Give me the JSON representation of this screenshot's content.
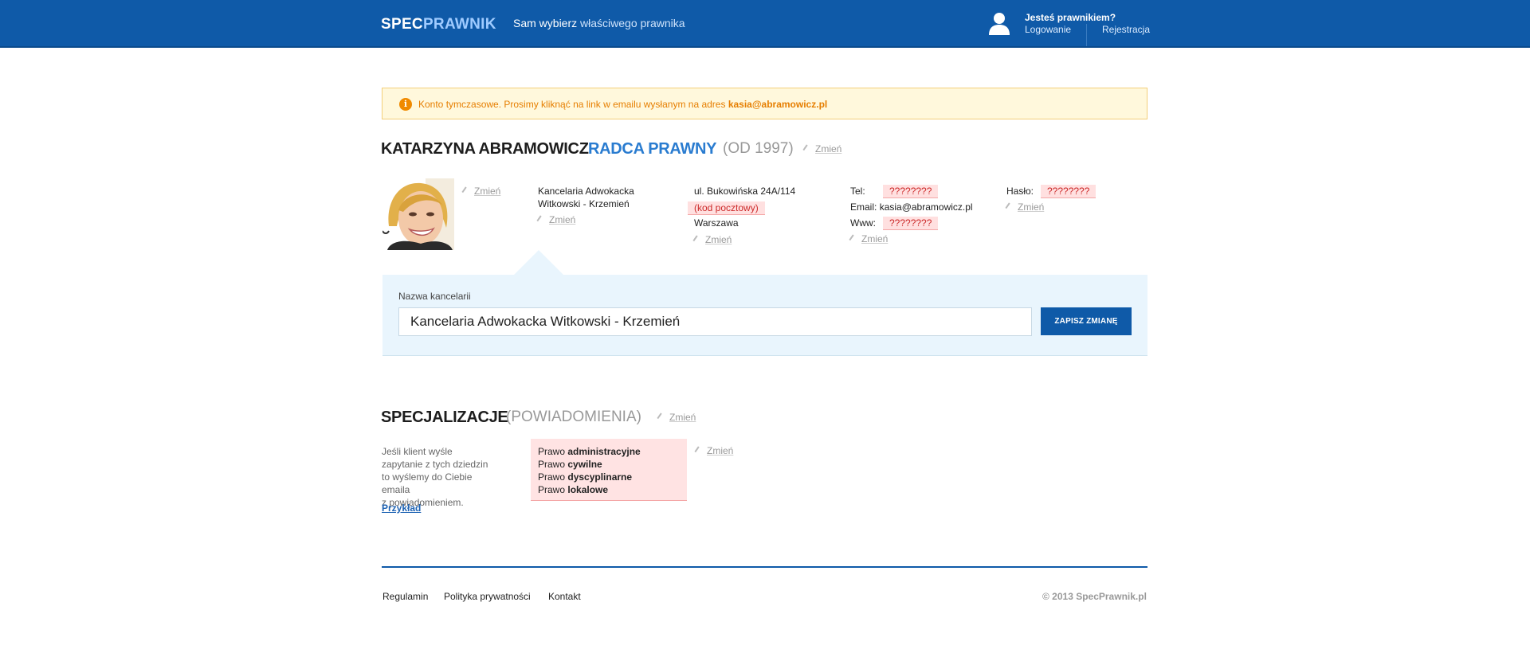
{
  "header": {
    "logo_a": "SPEC",
    "logo_b": "PRAWNIK",
    "tagline_a": "Sam wybierz",
    "tagline_b": " właściwego prawnika",
    "lawyer_question": "Jesteś prawnikiem?",
    "login": "Logowanie",
    "register": "Rejestracja"
  },
  "notice": {
    "icon": "i",
    "text": "Konto tymczasowe. Prosimy kliknąć na link w emailu wysłanym na adres ",
    "email": "kasia@abramowicz.pl"
  },
  "profile": {
    "name": "KATARZYNA ABRAMOWICZ",
    "title": "RADCA PRAWNY",
    "since": "(OD 1997)",
    "edit_label": "Zmień",
    "firm_line1": "Kancelaria Adwokacka",
    "firm_line2": "Witkowski - Krzemień",
    "street": "ul. Bukowińska 24A/114",
    "postal_placeholder": "(kod pocztowy)",
    "city": "Warszawa",
    "tel_label": "Tel:",
    "tel_value": "????????",
    "email_label": "Email:",
    "email_value": "kasia@abramowicz.pl",
    "www_label": "Www:",
    "www_value": "????????",
    "password_label": "Hasło:",
    "password_value": "????????"
  },
  "edit_panel": {
    "label": "Nazwa kancelarii",
    "value": "Kancelaria Adwokacka Witkowski - Krzemień",
    "save_button": "ZAPISZ ZMIANĘ"
  },
  "specializations": {
    "title": "SPECJALIZACJE",
    "subtitle": "(POWIADOMIENIA)",
    "edit_label": "Zmień",
    "desc_lines": [
      "Jeśli klient wyśle",
      "zapytanie z tych dziedzin",
      "to wyślemy do Ciebie emaila",
      "z powiadomieniem."
    ],
    "example": "Przykład",
    "prefix": "Prawo ",
    "items": [
      "administracyjne",
      "cywilne",
      "dyscyplinarne",
      "lokalowe"
    ]
  },
  "footer": {
    "links": [
      "Regulamin",
      "Polityka prywatności",
      "Kontakt"
    ],
    "copyright": "© 2013 SpecPrawnik.pl"
  },
  "colors": {
    "brand": "#0f5aa8",
    "accent": "#2a7cd0",
    "warning": "#e67e00",
    "missing": "#ffe0e0"
  }
}
